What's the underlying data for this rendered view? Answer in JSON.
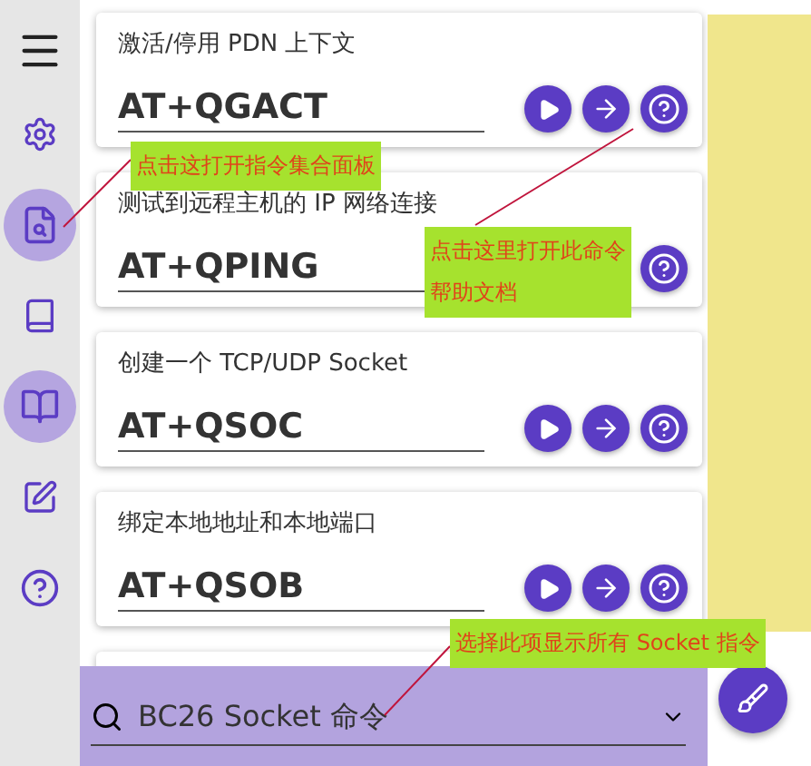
{
  "sidebar": {
    "items": [
      {
        "kind": "settings",
        "selected": false
      },
      {
        "kind": "doc-search",
        "selected": true
      },
      {
        "kind": "book",
        "selected": false
      },
      {
        "kind": "open-book",
        "selected": true
      },
      {
        "kind": "edit-table",
        "selected": false
      },
      {
        "kind": "help",
        "selected": false
      }
    ]
  },
  "commands": [
    {
      "description": "激活/停用 PDN 上下文",
      "command": "AT+QGACT",
      "buttons": [
        {
          "kind": "run"
        },
        {
          "kind": "send"
        },
        {
          "kind": "help"
        }
      ]
    },
    {
      "description": "测试到远程主机的 IP 网络连接",
      "command": "AT+QPING",
      "buttons": [
        {
          "kind": "help"
        }
      ]
    },
    {
      "description": "创建一个 TCP/UDP Socket",
      "command": "AT+QSOC",
      "buttons": [
        {
          "kind": "run"
        },
        {
          "kind": "send"
        },
        {
          "kind": "help"
        }
      ]
    },
    {
      "description": "绑定本地地址和本地端口",
      "command": "AT+QSOB",
      "buttons": [
        {
          "kind": "run"
        },
        {
          "kind": "send"
        },
        {
          "kind": "help"
        }
      ]
    }
  ],
  "command_set_select": {
    "value": "BC26 Socket 命令"
  },
  "annotations": [
    {
      "lines": [
        "点击这打开指令集合面板"
      ],
      "kind": "sidebar"
    },
    {
      "lines": [
        "点击这里打开此命令",
        "帮助文档"
      ],
      "kind": "help"
    },
    {
      "lines": [
        "选择此项显示所有 Socket 指令"
      ],
      "kind": "select"
    }
  ]
}
